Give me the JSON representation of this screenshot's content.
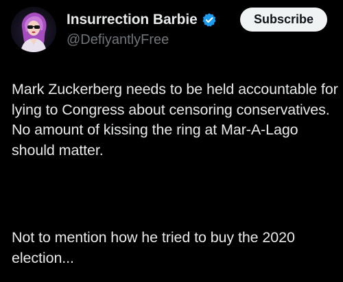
{
  "author": {
    "display_name": "Insurrection Barbie",
    "handle": "@DefiyantlyFree",
    "verified": true,
    "verified_icon": "verified-badge-icon",
    "verified_color": "#1d9bf0"
  },
  "actions": {
    "subscribe_label": "Subscribe"
  },
  "tweet": {
    "paragraphs": [
      "Mark Zuckerberg needs to be held accountable for lying to Congress about censoring conservatives. No amount of kissing the ring at Mar-A-Lago should matter.",
      "Not to mention how he tried to buy the 2020 election..."
    ]
  },
  "colors": {
    "background": "#000000",
    "text": "#e7e9ea",
    "secondary_text": "#71767b",
    "button_bg": "#eff3f4",
    "button_text": "#0f1419"
  }
}
